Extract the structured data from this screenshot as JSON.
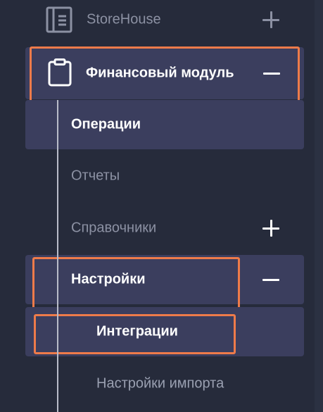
{
  "nav": {
    "storehouse": {
      "label": "StoreHouse",
      "toggle": "+"
    },
    "finance": {
      "label": "Финансовый модуль",
      "toggle": "−"
    },
    "operations": {
      "label": "Операции"
    },
    "reports": {
      "label": "Отчеты"
    },
    "directories": {
      "label": "Справочники",
      "toggle": "+"
    },
    "settings": {
      "label": "Настройки",
      "toggle": "−"
    },
    "integrations": {
      "label": "Интеграции"
    },
    "import_settings": {
      "label": "Настройки импорта"
    }
  },
  "colors": {
    "background": "#262b3b",
    "highlight": "#3b3e5e",
    "outline": "#ee7b4a",
    "text_bright": "#ffffff",
    "text_dim": "#8c91a3"
  }
}
